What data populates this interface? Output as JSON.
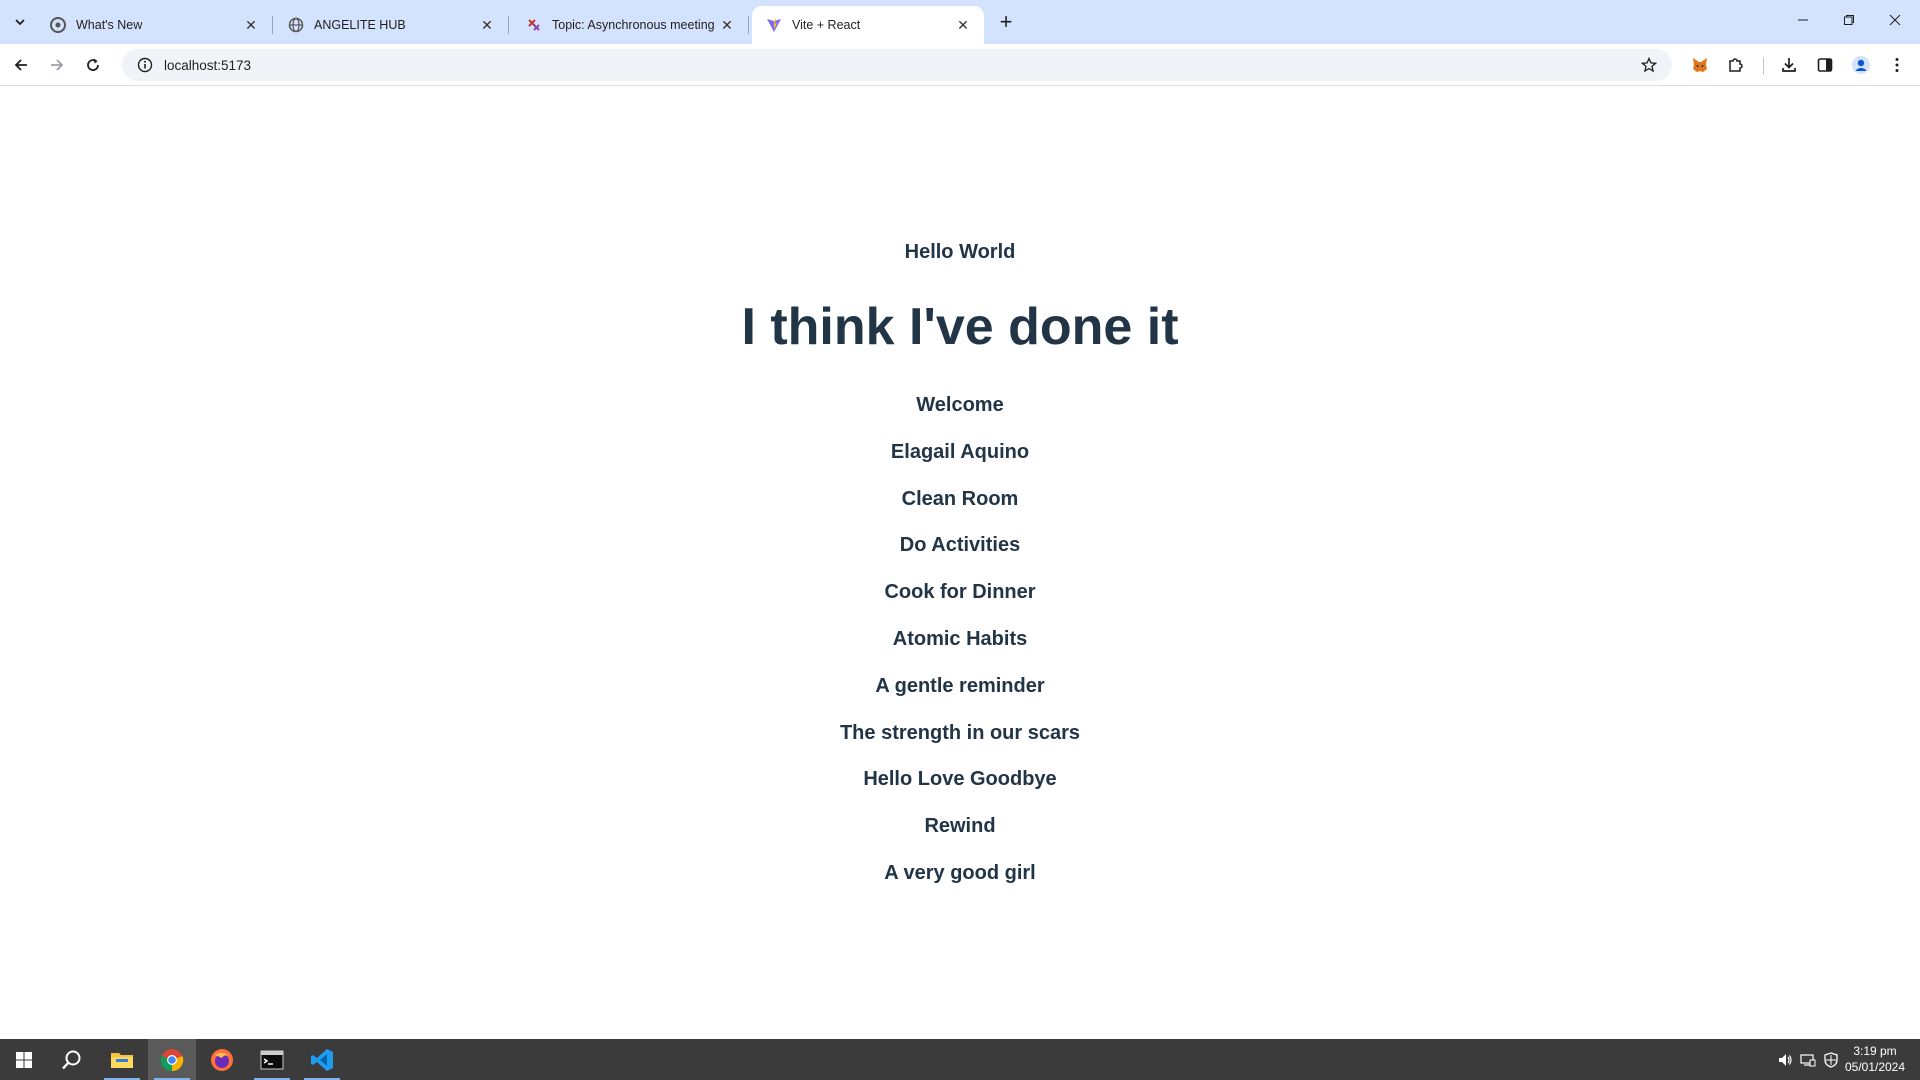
{
  "browser": {
    "tabs": [
      {
        "title": "What's New",
        "icon": "chrome-icon",
        "active": false
      },
      {
        "title": "ANGELITE HUB",
        "icon": "globe-icon",
        "active": false
      },
      {
        "title": "Topic: Asynchronous meeting",
        "icon": "forum-icon",
        "active": false
      },
      {
        "title": "Vite + React",
        "icon": "vite-icon",
        "active": true
      }
    ],
    "new_tab_label": "+",
    "url": "localhost:5173"
  },
  "page": {
    "hello": "Hello World",
    "headline": "I think I've done it",
    "items": [
      "Welcome",
      "Elagail Aquino",
      "Clean Room",
      "Do Activities",
      "Cook for Dinner",
      "Atomic Habits",
      "A gentle reminder",
      "The strength in our scars",
      "Hello Love Goodbye",
      "Rewind",
      "A very good girl"
    ]
  },
  "taskbar": {
    "apps": [
      "start-icon",
      "search-icon",
      "file-explorer-icon",
      "chrome-icon",
      "firefox-icon",
      "terminal-icon",
      "vscode-icon"
    ],
    "time": "3:19 pm",
    "date": "05/01/2024"
  },
  "colors": {
    "tabstrip": "#d3e3fd",
    "text": "#213547",
    "taskbar": "#3b3b3b"
  }
}
